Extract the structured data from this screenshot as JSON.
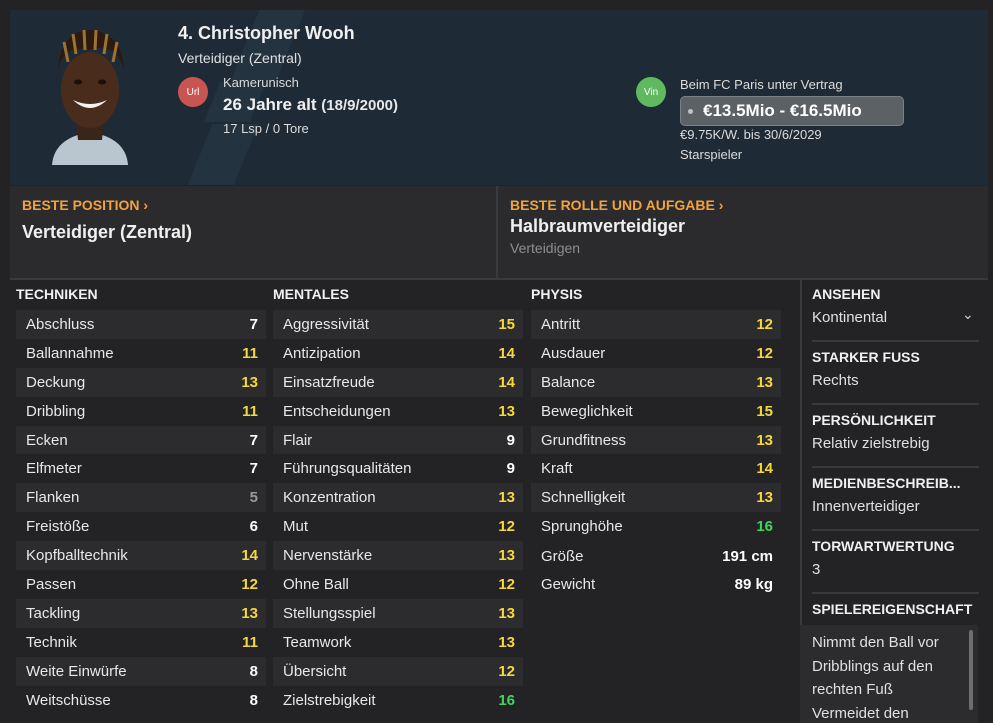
{
  "player": {
    "name": "4. Christopher Wooh",
    "position": "Verteidiger (Zentral)",
    "nationality_badge": "Url",
    "nationality": "Kamerunisch",
    "age": "26 Jahre alt",
    "dob": "(18/9/2000)",
    "apps": "17 Lsp / 0 Tore",
    "club_badge": "Vin",
    "contract": "Beim FC Paris unter Vertrag",
    "value": "€13.5Mio - €16.5Mio",
    "wage": "€9.75K/W. bis 30/6/2029",
    "status": "Starspieler"
  },
  "best_position": {
    "heading": "BESTE POSITION ›",
    "value": "Verteidiger (Zentral)"
  },
  "best_role": {
    "heading": "BESTE ROLLE UND AUFGABE ›",
    "value": "Halbraumverteidiger",
    "sub": "Verteidigen"
  },
  "technical": {
    "heading": "TECHNIKEN",
    "items": [
      {
        "label": "Abschluss",
        "value": "7"
      },
      {
        "label": "Ballannahme",
        "value": "11"
      },
      {
        "label": "Deckung",
        "value": "13"
      },
      {
        "label": "Dribbling",
        "value": "11"
      },
      {
        "label": "Ecken",
        "value": "7"
      },
      {
        "label": "Elfmeter",
        "value": "7"
      },
      {
        "label": "Flanken",
        "value": "5"
      },
      {
        "label": "Freistöße",
        "value": "6"
      },
      {
        "label": "Kopfballtechnik",
        "value": "14"
      },
      {
        "label": "Passen",
        "value": "12"
      },
      {
        "label": "Tackling",
        "value": "13"
      },
      {
        "label": "Technik",
        "value": "11"
      },
      {
        "label": "Weite Einwürfe",
        "value": "8"
      },
      {
        "label": "Weitschüsse",
        "value": "8"
      }
    ]
  },
  "mental": {
    "heading": "MENTALES",
    "items": [
      {
        "label": "Aggressivität",
        "value": "15"
      },
      {
        "label": "Antizipation",
        "value": "14"
      },
      {
        "label": "Einsatzfreude",
        "value": "14"
      },
      {
        "label": "Entscheidungen",
        "value": "13"
      },
      {
        "label": "Flair",
        "value": "9"
      },
      {
        "label": "Führungsqualitäten",
        "value": "9"
      },
      {
        "label": "Konzentration",
        "value": "13"
      },
      {
        "label": "Mut",
        "value": "12"
      },
      {
        "label": "Nervenstärke",
        "value": "13"
      },
      {
        "label": "Ohne Ball",
        "value": "12"
      },
      {
        "label": "Stellungsspiel",
        "value": "13"
      },
      {
        "label": "Teamwork",
        "value": "13"
      },
      {
        "label": "Übersicht",
        "value": "12"
      },
      {
        "label": "Zielstrebigkeit",
        "value": "16"
      }
    ]
  },
  "physical": {
    "heading": "PHYSIS",
    "items": [
      {
        "label": "Antritt",
        "value": "12"
      },
      {
        "label": "Ausdauer",
        "value": "12"
      },
      {
        "label": "Balance",
        "value": "13"
      },
      {
        "label": "Beweglichkeit",
        "value": "15"
      },
      {
        "label": "Grundfitness",
        "value": "13"
      },
      {
        "label": "Kraft",
        "value": "14"
      },
      {
        "label": "Schnelligkeit",
        "value": "13"
      },
      {
        "label": "Sprunghöhe",
        "value": "16"
      }
    ],
    "height_label": "Größe",
    "height_value": "191 cm",
    "weight_label": "Gewicht",
    "weight_value": "89 kg"
  },
  "sidebar": {
    "reputation_head": "ANSEHEN",
    "reputation": "Kontinental",
    "foot_head": "STARKER FUSS",
    "foot": "Rechts",
    "personality_head": "PERSÖNLICHKEIT",
    "personality": "Relativ zielstrebig",
    "media_head": "MEDIENBESCHREIB...",
    "media": "Innenverteidiger",
    "gk_head": "TORWARTWERTUNG",
    "gk": "3",
    "traits_head": "SPIELEREIGENSCHAFT",
    "traits": [
      "Nimmt den Ball vor Dribblings auf den rechten Fuß",
      "Vermeidet den"
    ]
  },
  "colors": {
    "white": "#ffffff",
    "grey": "#9a9a9a",
    "yellow": "#f5d83a",
    "green": "#3fd65f",
    "accent_orange": "#f2a23a"
  }
}
